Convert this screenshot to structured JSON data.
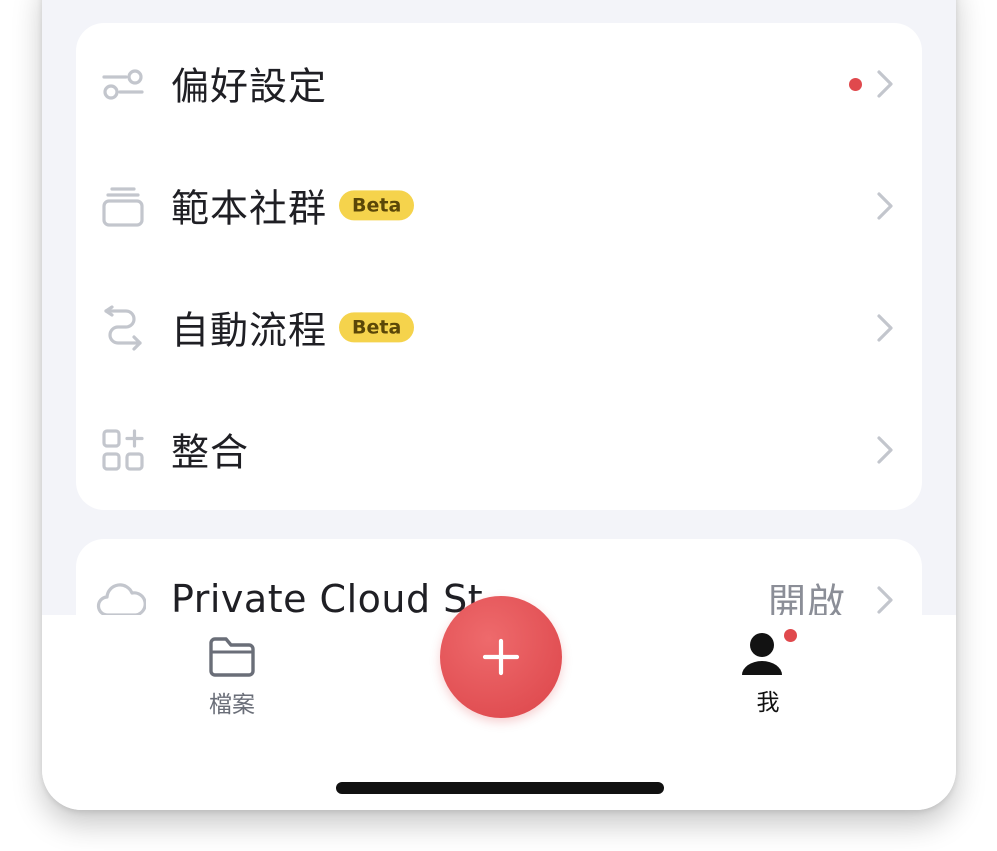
{
  "settings_menu": {
    "items": [
      {
        "label": "偏好設定",
        "icon": "sliders-icon",
        "has_dot": true
      },
      {
        "label": "範本社群",
        "icon": "template-stack-icon",
        "badge": "Beta"
      },
      {
        "label": "自動流程",
        "icon": "workflow-icon",
        "badge": "Beta"
      },
      {
        "label": "整合",
        "icon": "integrations-grid-icon"
      }
    ]
  },
  "private_cloud": {
    "label": "Private Cloud St",
    "icon": "cloud-icon",
    "value": "開啟"
  },
  "tab_bar": {
    "files_label": "檔案",
    "me_label": "我",
    "add_icon": "plus-icon"
  },
  "colors": {
    "accent": "#DF4A4E",
    "beta_badge": "#F5D34C",
    "notification_dot": "#E0494D",
    "background": "#F3F4F9"
  }
}
